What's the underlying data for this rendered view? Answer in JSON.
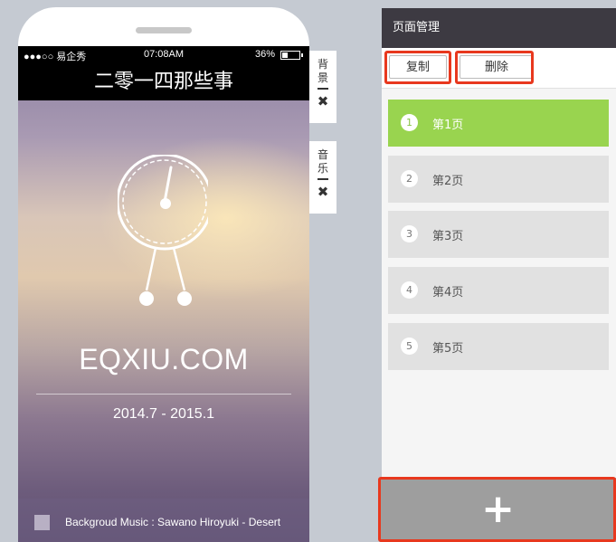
{
  "phone": {
    "status": {
      "carrier": "●●●○○ 易企秀",
      "time": "07:08AM",
      "battery": "36%",
      "battery_level": 0.36
    },
    "title": "二零一四那些事",
    "brand": "EQXIU.COM",
    "date_range": "2014.7 - 2015.1",
    "music_text": "Backgroud Music : Sawano Hiroyuki - Desert"
  },
  "side_tabs": [
    {
      "label": "背景",
      "close": "✖"
    },
    {
      "label": "音乐",
      "close": "✖"
    }
  ],
  "panel": {
    "header": "页面管理",
    "copy_label": "复制",
    "delete_label": "删除",
    "pages": [
      {
        "num": "1",
        "label": "第1页",
        "active": true
      },
      {
        "num": "2",
        "label": "第2页",
        "active": false
      },
      {
        "num": "3",
        "label": "第3页",
        "active": false
      },
      {
        "num": "4",
        "label": "第4页",
        "active": false
      },
      {
        "num": "5",
        "label": "第5页",
        "active": false
      }
    ],
    "add_label": "+"
  },
  "colors": {
    "active_page": "#99d44f",
    "highlight": "#e8381e",
    "panel_header": "#3d3a42"
  }
}
